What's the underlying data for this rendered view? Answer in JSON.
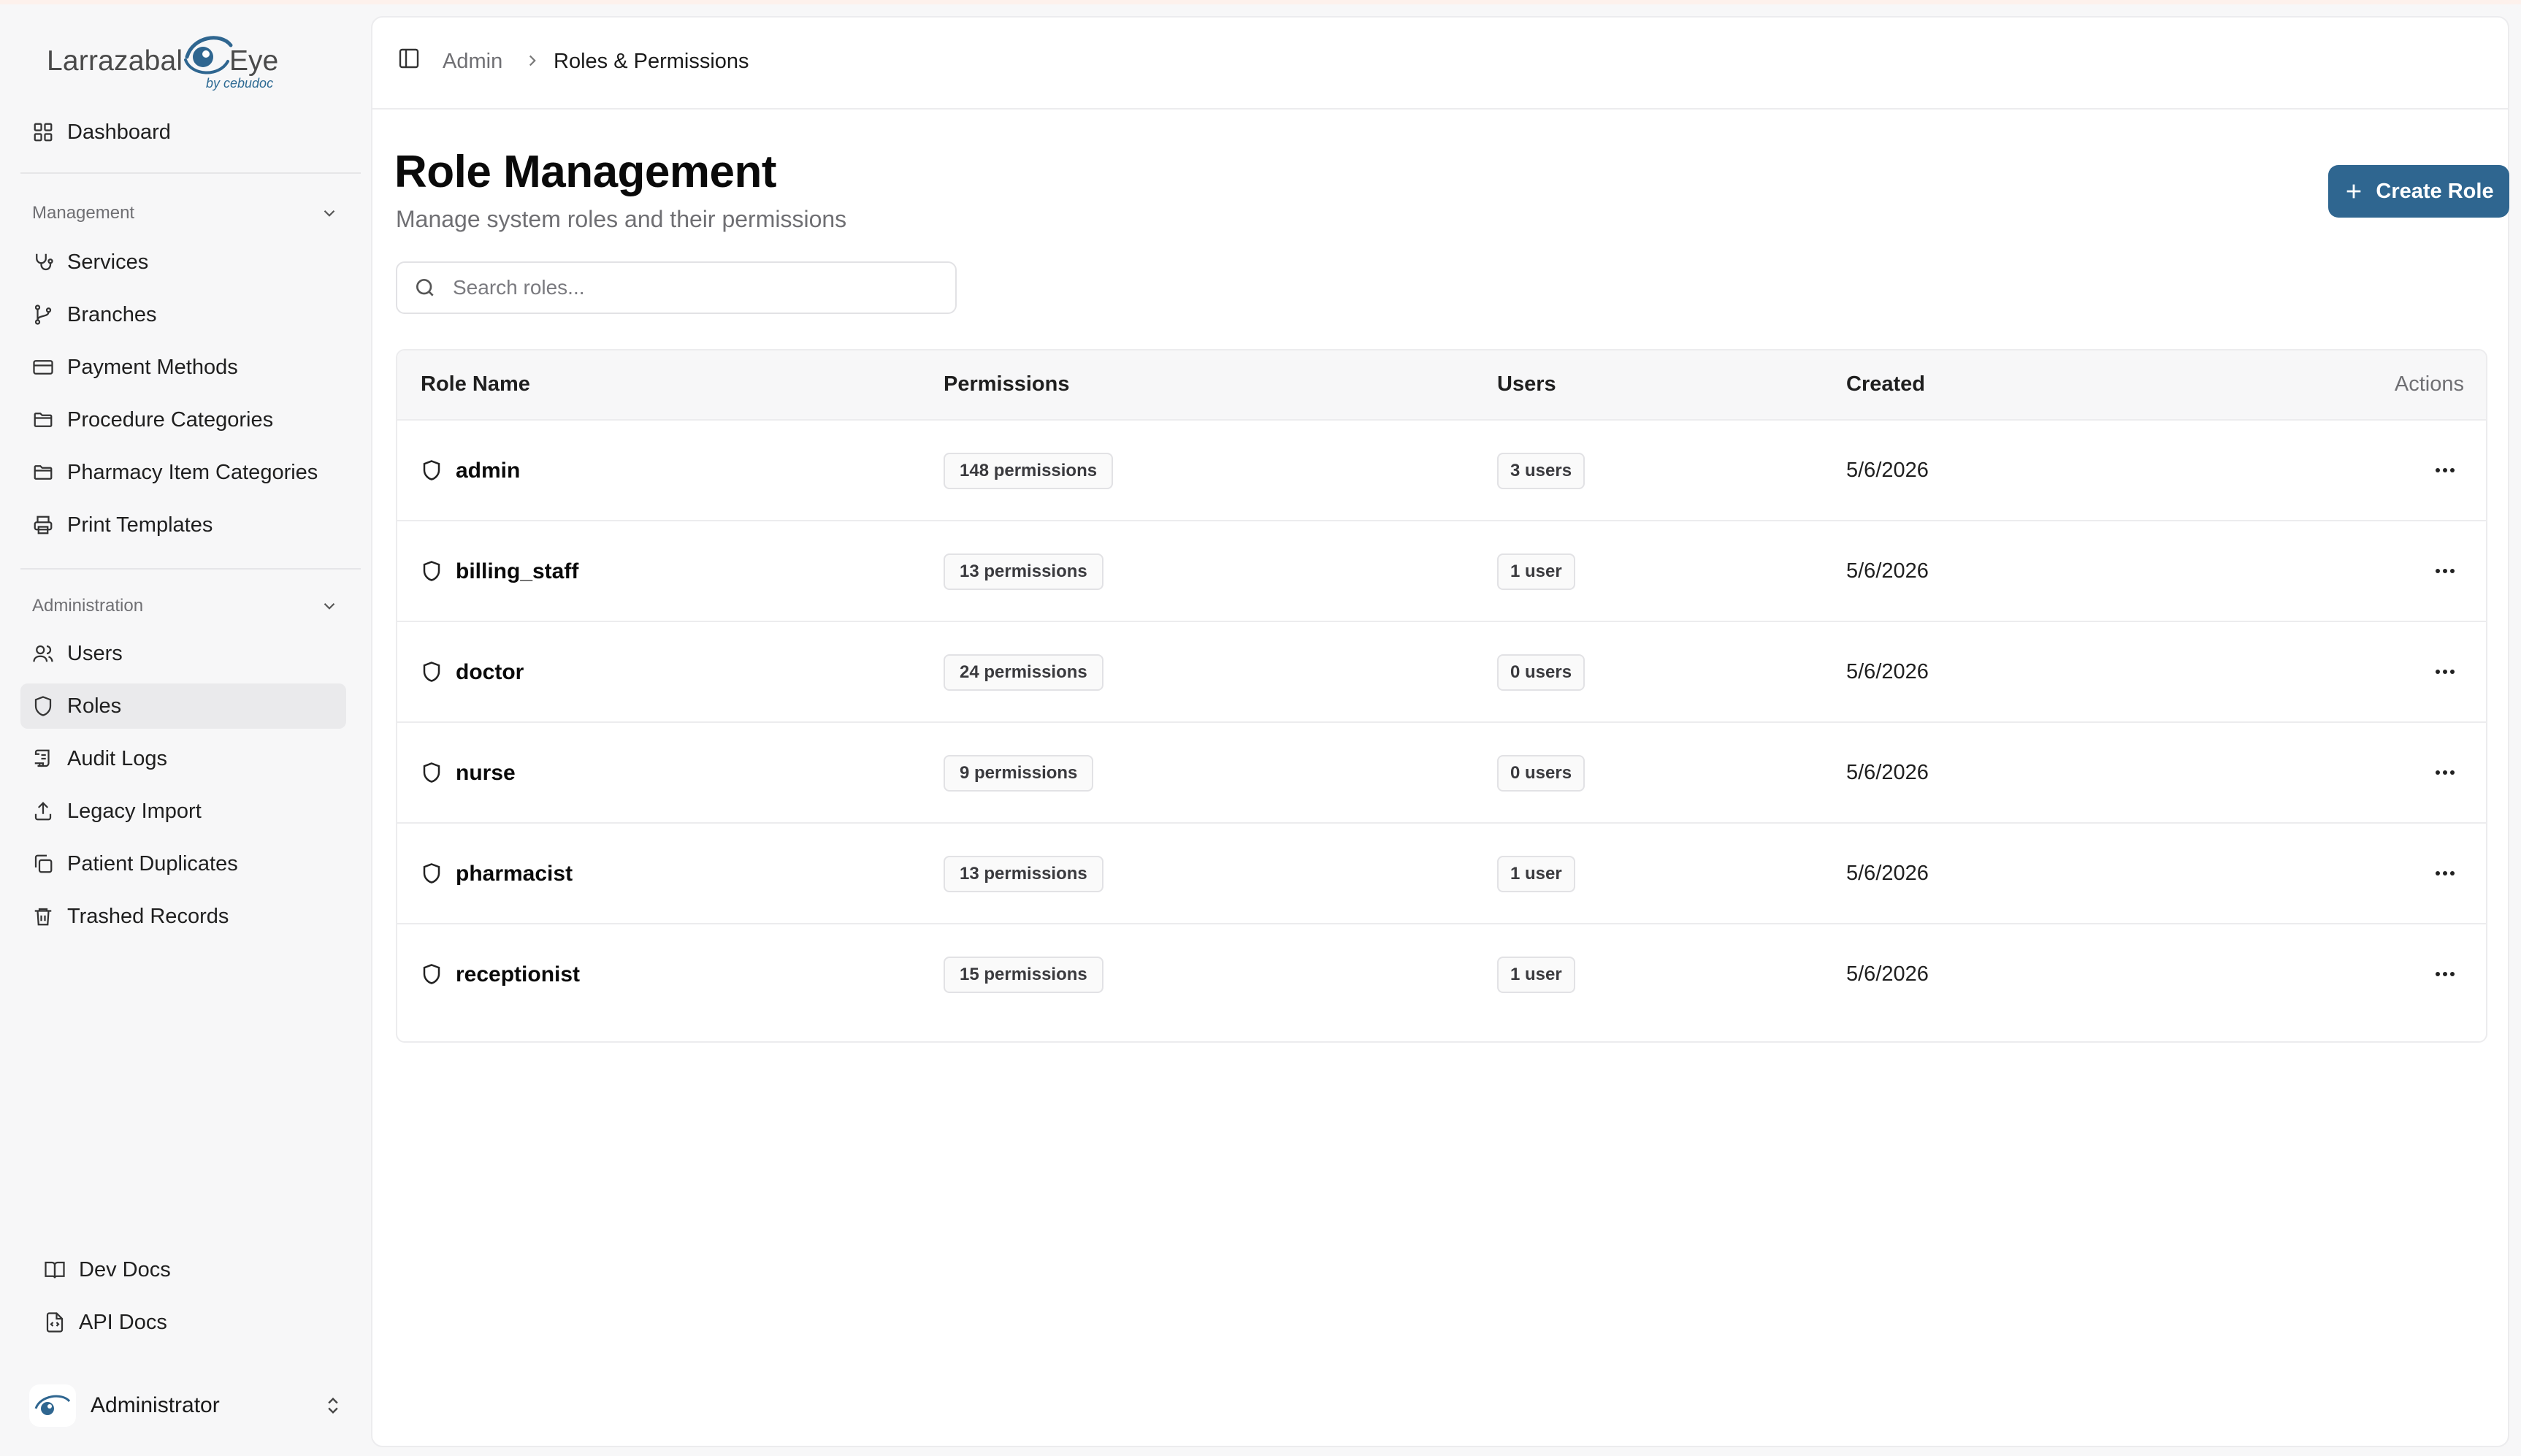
{
  "app": {
    "logo_text": "Larrazabal",
    "logo_eye_word": "Eye",
    "logo_sub": "by cebudoc",
    "accent_color": "#2f6690"
  },
  "sidebar": {
    "dashboard": "Dashboard",
    "management_label": "Management",
    "management_items": [
      {
        "label": "Services",
        "icon": "stethoscope-icon"
      },
      {
        "label": "Branches",
        "icon": "git-branch-icon"
      },
      {
        "label": "Payment Methods",
        "icon": "credit-card-icon"
      },
      {
        "label": "Procedure Categories",
        "icon": "folder-icon"
      },
      {
        "label": "Pharmacy Item Categories",
        "icon": "folder-icon"
      },
      {
        "label": "Print Templates",
        "icon": "printer-icon"
      }
    ],
    "administration_label": "Administration",
    "administration_items": [
      {
        "label": "Users",
        "icon": "users-icon"
      },
      {
        "label": "Roles",
        "icon": "shield-icon",
        "active": true
      },
      {
        "label": "Audit Logs",
        "icon": "scroll-icon"
      },
      {
        "label": "Legacy Import",
        "icon": "upload-icon"
      },
      {
        "label": "Patient Duplicates",
        "icon": "copy-icon"
      },
      {
        "label": "Trashed Records",
        "icon": "trash-icon"
      }
    ],
    "footer_items": [
      {
        "label": "Dev Docs",
        "icon": "book-open-icon"
      },
      {
        "label": "API Docs",
        "icon": "file-code-icon"
      }
    ],
    "user": {
      "name": "Administrator"
    }
  },
  "breadcrumb": {
    "parent": "Admin",
    "current": "Roles & Permissions"
  },
  "page": {
    "title": "Role Management",
    "subtitle": "Manage system roles and their permissions",
    "create_button": "Create Role",
    "search_placeholder": "Search roles..."
  },
  "table": {
    "columns": {
      "role_name": "Role Name",
      "permissions": "Permissions",
      "users": "Users",
      "created": "Created",
      "actions": "Actions"
    },
    "rows": [
      {
        "name": "admin",
        "permissions": "148 permissions",
        "users": "3 users",
        "created": "5/6/2026"
      },
      {
        "name": "billing_staff",
        "permissions": "13 permissions",
        "users": "1 user",
        "created": "5/6/2026"
      },
      {
        "name": "doctor",
        "permissions": "24 permissions",
        "users": "0 users",
        "created": "5/6/2026"
      },
      {
        "name": "nurse",
        "permissions": "9 permissions",
        "users": "0 users",
        "created": "5/6/2026"
      },
      {
        "name": "pharmacist",
        "permissions": "13 permissions",
        "users": "1 user",
        "created": "5/6/2026"
      },
      {
        "name": "receptionist",
        "permissions": "15 permissions",
        "users": "1 user",
        "created": "5/6/2026"
      }
    ]
  }
}
